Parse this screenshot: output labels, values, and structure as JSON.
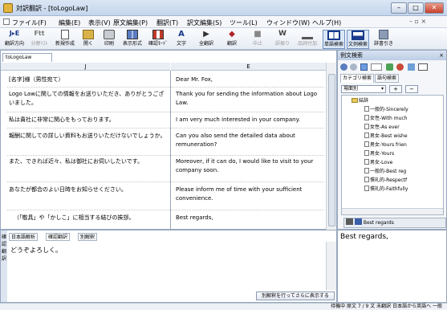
{
  "window": {
    "title": "対訳翻訳 - [toLogoLaw]",
    "controls": {
      "minimize": "–",
      "maximize": "□",
      "close": "✕",
      "mdi": "– ▫ ×"
    }
  },
  "menu": [
    "ファイル(F)",
    "編集(E)",
    "表示(V)",
    "原文編集(P)",
    "翻訳(T)",
    "訳文編集(S)",
    "ツール(L)",
    "ウィンドウ(W)",
    "ヘルプ(H)"
  ],
  "toolbar": {
    "buttons": [
      {
        "label": "翻訳方向",
        "glyph": "J▸E",
        "icon": "direction-icon"
      },
      {
        "label": "分野ﾘｽﾄ",
        "glyph": "Ftt",
        "icon": "field-list-icon"
      },
      {
        "label": "新規作成",
        "glyph": "",
        "icon": "new-doc-icon"
      },
      {
        "label": "開く",
        "glyph": "",
        "icon": "open-folder-icon"
      },
      {
        "label": "印刷",
        "glyph": "",
        "icon": "print-icon"
      },
      {
        "label": "表示形式",
        "glyph": "",
        "icon": "display-format-icon"
      },
      {
        "label": "確認ﾓｰﾄﾞ",
        "glyph": "",
        "icon": "check-mode-icon"
      },
      {
        "label": "文字",
        "glyph": "A",
        "icon": "font-icon"
      },
      {
        "label": "全翻訳",
        "glyph": "▶",
        "icon": "translate-all-icon"
      },
      {
        "label": "翻訳",
        "glyph": "◆",
        "icon": "translate-icon"
      },
      {
        "label": "中止",
        "glyph": "■",
        "icon": "stop-icon"
      },
      {
        "label": "訳振り",
        "glyph": "W",
        "icon": "ruby-icon"
      },
      {
        "label": "品詞付加",
        "glyph": "",
        "icon": "pos-tag-icon"
      },
      {
        "label": "単語検索",
        "glyph": "",
        "icon": "word-search-icon"
      },
      {
        "label": "文例検索",
        "glyph": "",
        "icon": "example-search-icon"
      },
      {
        "label": "辞書引き",
        "glyph": "",
        "icon": "dictionary-icon"
      }
    ]
  },
  "document": {
    "tab": "toLogoLaw",
    "col_j": "J",
    "col_e": "E",
    "rows": [
      {
        "j": "[名字]様（男性宛て）",
        "e": "Dear Mr. Fox,"
      },
      {
        "j": "Logo Lawに関しての情報をお送りいただき、ありがとうございました。",
        "e": "Thank you for sending the information about Logo Law."
      },
      {
        "j": "私は貴社に非常に関心をもっております。",
        "e": "I am very much interested in your company."
      },
      {
        "j": "報酬に関しての詳しい資料もお送りいただけないでしょうか。",
        "e": "Can you also send the detailed data about remuneration?"
      },
      {
        "j": "また、できれば近々、私は御社にお伺いしたいです。",
        "e": "Moreover, if it can do, I would like to visit to your company soon."
      },
      {
        "j": "あなたが都合のよい日時をお知らせください。",
        "e": "Please inform me of time with your sufficient convenience."
      },
      {
        "j": "（「敬具」や「かしこ」に相当する結びの挨拶。",
        "e": "Best regards,"
      }
    ]
  },
  "example_search": {
    "title": "例文検索",
    "close": "×",
    "tabs": [
      "カテゴリ検索",
      "語句検索"
    ],
    "dropdown": "場面別",
    "add": "+",
    "remove": "−",
    "tree_root": "結辞",
    "items": [
      "一般的-Sincerely",
      "女性-With much",
      "女性-As ever",
      "男女-Best wishe",
      "男女-Yours frien",
      "男女-Yours",
      "男女-Love",
      "一般的-Best reg",
      "慣礼的-Respectf",
      "慣礼的-Faithfully"
    ],
    "result_label": "Best regards",
    "result_text": "Best regards,"
  },
  "bottom": {
    "tabs": [
      "日本語解析",
      "確認翻訳",
      "別解釈"
    ],
    "side_label": "確認翻訳",
    "text": "どうぞよろしく。",
    "button": "別解釈を行ってさらに表示する"
  },
  "status": {
    "text": "待機中  原文  7 / 9 文  未翻訳  日本語から英語へ  一般"
  }
}
